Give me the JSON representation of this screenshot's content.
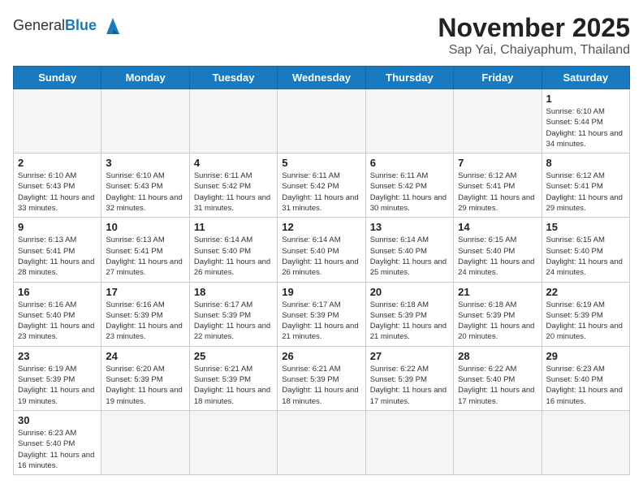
{
  "header": {
    "logo_line1": "General",
    "logo_line2": "Blue",
    "month_title": "November 2025",
    "subtitle": "Sap Yai, Chaiyaphum, Thailand"
  },
  "weekdays": [
    "Sunday",
    "Monday",
    "Tuesday",
    "Wednesday",
    "Thursday",
    "Friday",
    "Saturday"
  ],
  "weeks": [
    [
      {
        "day": "",
        "empty": true
      },
      {
        "day": "",
        "empty": true
      },
      {
        "day": "",
        "empty": true
      },
      {
        "day": "",
        "empty": true
      },
      {
        "day": "",
        "empty": true
      },
      {
        "day": "",
        "empty": true
      },
      {
        "day": "1",
        "sunrise": "6:10 AM",
        "sunset": "5:44 PM",
        "daylight": "11 hours and 34 minutes."
      }
    ],
    [
      {
        "day": "2",
        "sunrise": "6:10 AM",
        "sunset": "5:43 PM",
        "daylight": "11 hours and 33 minutes."
      },
      {
        "day": "3",
        "sunrise": "6:10 AM",
        "sunset": "5:43 PM",
        "daylight": "11 hours and 32 minutes."
      },
      {
        "day": "4",
        "sunrise": "6:11 AM",
        "sunset": "5:42 PM",
        "daylight": "11 hours and 31 minutes."
      },
      {
        "day": "5",
        "sunrise": "6:11 AM",
        "sunset": "5:42 PM",
        "daylight": "11 hours and 31 minutes."
      },
      {
        "day": "6",
        "sunrise": "6:11 AM",
        "sunset": "5:42 PM",
        "daylight": "11 hours and 30 minutes."
      },
      {
        "day": "7",
        "sunrise": "6:12 AM",
        "sunset": "5:41 PM",
        "daylight": "11 hours and 29 minutes."
      },
      {
        "day": "8",
        "sunrise": "6:12 AM",
        "sunset": "5:41 PM",
        "daylight": "11 hours and 29 minutes."
      }
    ],
    [
      {
        "day": "9",
        "sunrise": "6:13 AM",
        "sunset": "5:41 PM",
        "daylight": "11 hours and 28 minutes."
      },
      {
        "day": "10",
        "sunrise": "6:13 AM",
        "sunset": "5:41 PM",
        "daylight": "11 hours and 27 minutes."
      },
      {
        "day": "11",
        "sunrise": "6:14 AM",
        "sunset": "5:40 PM",
        "daylight": "11 hours and 26 minutes."
      },
      {
        "day": "12",
        "sunrise": "6:14 AM",
        "sunset": "5:40 PM",
        "daylight": "11 hours and 26 minutes."
      },
      {
        "day": "13",
        "sunrise": "6:14 AM",
        "sunset": "5:40 PM",
        "daylight": "11 hours and 25 minutes."
      },
      {
        "day": "14",
        "sunrise": "6:15 AM",
        "sunset": "5:40 PM",
        "daylight": "11 hours and 24 minutes."
      },
      {
        "day": "15",
        "sunrise": "6:15 AM",
        "sunset": "5:40 PM",
        "daylight": "11 hours and 24 minutes."
      }
    ],
    [
      {
        "day": "16",
        "sunrise": "6:16 AM",
        "sunset": "5:40 PM",
        "daylight": "11 hours and 23 minutes."
      },
      {
        "day": "17",
        "sunrise": "6:16 AM",
        "sunset": "5:39 PM",
        "daylight": "11 hours and 23 minutes."
      },
      {
        "day": "18",
        "sunrise": "6:17 AM",
        "sunset": "5:39 PM",
        "daylight": "11 hours and 22 minutes."
      },
      {
        "day": "19",
        "sunrise": "6:17 AM",
        "sunset": "5:39 PM",
        "daylight": "11 hours and 21 minutes."
      },
      {
        "day": "20",
        "sunrise": "6:18 AM",
        "sunset": "5:39 PM",
        "daylight": "11 hours and 21 minutes."
      },
      {
        "day": "21",
        "sunrise": "6:18 AM",
        "sunset": "5:39 PM",
        "daylight": "11 hours and 20 minutes."
      },
      {
        "day": "22",
        "sunrise": "6:19 AM",
        "sunset": "5:39 PM",
        "daylight": "11 hours and 20 minutes."
      }
    ],
    [
      {
        "day": "23",
        "sunrise": "6:19 AM",
        "sunset": "5:39 PM",
        "daylight": "11 hours and 19 minutes."
      },
      {
        "day": "24",
        "sunrise": "6:20 AM",
        "sunset": "5:39 PM",
        "daylight": "11 hours and 19 minutes."
      },
      {
        "day": "25",
        "sunrise": "6:21 AM",
        "sunset": "5:39 PM",
        "daylight": "11 hours and 18 minutes."
      },
      {
        "day": "26",
        "sunrise": "6:21 AM",
        "sunset": "5:39 PM",
        "daylight": "11 hours and 18 minutes."
      },
      {
        "day": "27",
        "sunrise": "6:22 AM",
        "sunset": "5:39 PM",
        "daylight": "11 hours and 17 minutes."
      },
      {
        "day": "28",
        "sunrise": "6:22 AM",
        "sunset": "5:40 PM",
        "daylight": "11 hours and 17 minutes."
      },
      {
        "day": "29",
        "sunrise": "6:23 AM",
        "sunset": "5:40 PM",
        "daylight": "11 hours and 16 minutes."
      }
    ],
    [
      {
        "day": "30",
        "sunrise": "6:23 AM",
        "sunset": "5:40 PM",
        "daylight": "11 hours and 16 minutes."
      },
      {
        "day": "",
        "empty": true
      },
      {
        "day": "",
        "empty": true
      },
      {
        "day": "",
        "empty": true
      },
      {
        "day": "",
        "empty": true
      },
      {
        "day": "",
        "empty": true
      },
      {
        "day": "",
        "empty": true
      }
    ]
  ],
  "labels": {
    "sunrise_label": "Sunrise:",
    "sunset_label": "Sunset:",
    "daylight_label": "Daylight:"
  }
}
